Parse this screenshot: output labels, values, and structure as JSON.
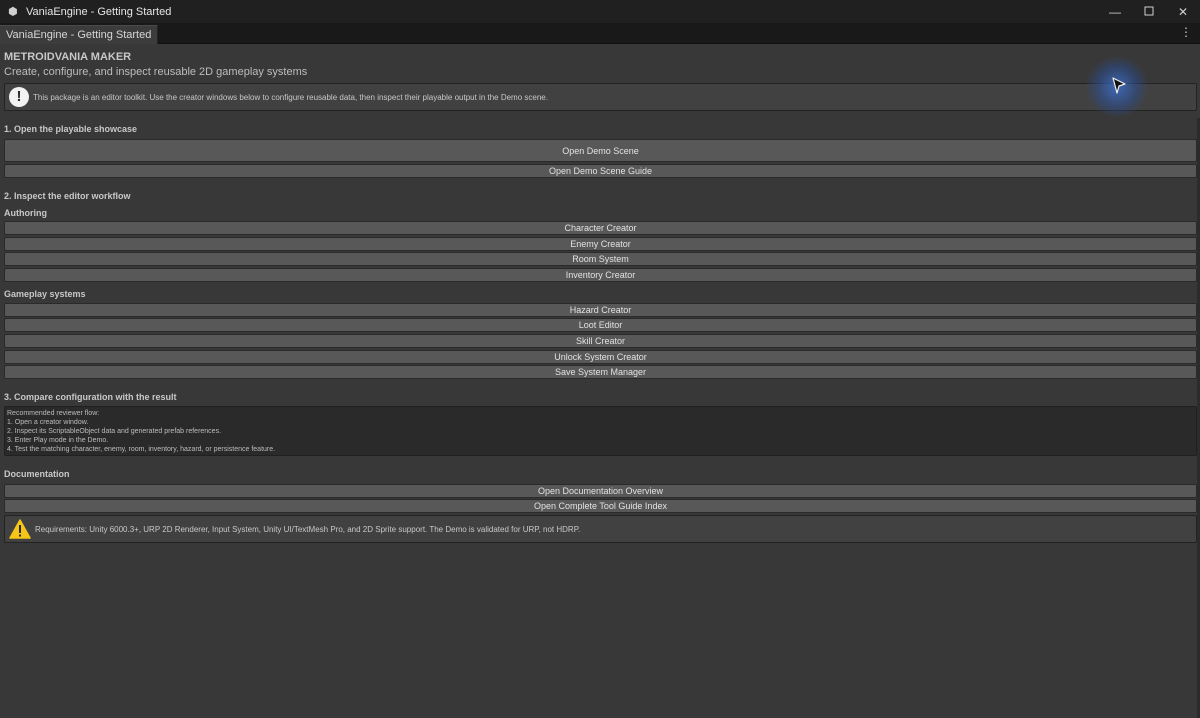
{
  "window": {
    "title": "VaniaEngine - Getting Started",
    "minimize_icon": "minimize-icon",
    "maximize_icon": "maximize-icon",
    "close_icon": "close-icon"
  },
  "tab": {
    "label": "VaniaEngine - Getting Started"
  },
  "header": {
    "title": "METROIDVANIA MAKER",
    "subtitle": "Create, configure, and inspect reusable 2D gameplay systems"
  },
  "info_box": {
    "icon": "info-icon",
    "text": "This package is an editor toolkit. Use the creator windows below to configure reusable data, then inspect their playable output in the Demo scene."
  },
  "section1": {
    "title": "1. Open the playable showcase",
    "open_demo_scene": "Open Demo Scene",
    "open_demo_guide": "Open Demo Scene Guide"
  },
  "section2": {
    "title": "2. Inspect the editor workflow",
    "authoring_label": "Authoring",
    "authoring_buttons": [
      "Character Creator",
      "Enemy Creator",
      "Room System",
      "Inventory Creator"
    ],
    "gameplay_label": "Gameplay systems",
    "gameplay_buttons": [
      "Hazard Creator",
      "Loot Editor",
      "Skill Creator",
      "Unlock System Creator",
      "Save System Manager"
    ]
  },
  "section3": {
    "title": "3. Compare configuration with the result",
    "flow_lines": [
      "Recommended reviewer flow:",
      "1. Open a creator window.",
      "2. Inspect its ScriptableObject data and generated prefab references.",
      "3. Enter Play mode in the Demo.",
      "4. Test the matching character, enemy, room, inventory, hazard, or persistence feature."
    ]
  },
  "documentation": {
    "title": "Documentation",
    "overview_button": "Open Documentation Overview",
    "tool_guide_button": "Open Complete Tool Guide Index"
  },
  "requirements_box": {
    "icon": "warning-icon",
    "text": "Requirements: Unity 6000.3+, URP 2D Renderer, Input System, Unity UI/TextMesh Pro, and 2D Sprite support. The Demo is validated for URP, not HDRP."
  }
}
